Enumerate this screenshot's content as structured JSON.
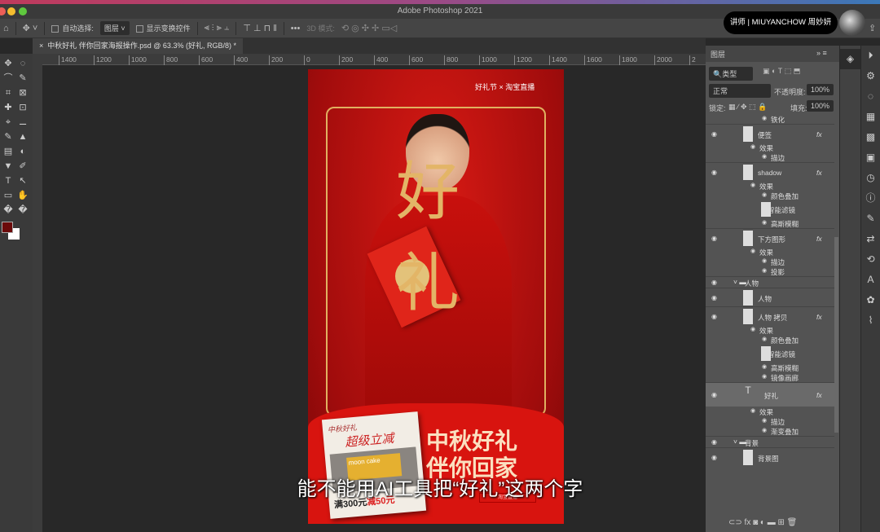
{
  "app": {
    "title": "Adobe Photoshop 2021"
  },
  "options": {
    "auto_select_label": "自动选择:",
    "auto_select_value": "图层",
    "show_transform_label": "显示变换控件",
    "mode_3d": "3D 模式:"
  },
  "badge": {
    "text": "讲师 | MIUYANCHOW 周妙妍"
  },
  "document": {
    "tab": "中秋好礼 伴你回家海报操作.psd @ 63.3% (好礼, RGB/8) *"
  },
  "ruler": [
    "1400",
    "1200",
    "1000",
    "800",
    "600",
    "400",
    "200",
    "0",
    "200",
    "400",
    "600",
    "800",
    "1000",
    "1200",
    "1400",
    "1600",
    "1800",
    "2000",
    "2"
  ],
  "colors": {
    "foreground": "#6b0a0a",
    "background": "#ffffff",
    "poster_red": "#d8140f",
    "gold": "#e3b567"
  },
  "poster": {
    "brand": "好礼节 × 淘宝直播",
    "big_text": "好礼",
    "headline1": "中秋好礼",
    "headline2": "伴你回家",
    "card_line1": "中秋好礼",
    "card_line2": "超级立减",
    "card_product": "moon cake",
    "card_price_a": "满300元",
    "card_price_b": "减50元",
    "live_label": "淘宝直播"
  },
  "caption": "能不能用AI工具把“好礼”这两个字",
  "layers_panel": {
    "title": "图层",
    "filter": "类型",
    "blend": "正常",
    "opacity_label": "不透明度:",
    "opacity": "100%",
    "lock_label": "锁定:",
    "fill_label": "填充:",
    "fill": "100%",
    "rows": [
      {
        "name": "铁化",
        "kind": "sub2"
      },
      {
        "name": "便签",
        "kind": "layer",
        "fx": "fx"
      },
      {
        "name": "效果",
        "kind": "sub1"
      },
      {
        "name": "描边",
        "kind": "sub2"
      },
      {
        "name": "shadow",
        "kind": "layer",
        "fx": "fx"
      },
      {
        "name": "效果",
        "kind": "sub1"
      },
      {
        "name": "颜色叠加",
        "kind": "sub2"
      },
      {
        "name": "智能滤镜",
        "kind": "filter"
      },
      {
        "name": "高斯模糊",
        "kind": "sub2"
      },
      {
        "name": "下方图形",
        "kind": "layer",
        "fx": "fx"
      },
      {
        "name": "效果",
        "kind": "sub1"
      },
      {
        "name": "描边",
        "kind": "sub2"
      },
      {
        "name": "投影",
        "kind": "sub2"
      },
      {
        "name": "人物",
        "kind": "group"
      },
      {
        "name": "人物",
        "kind": "layer",
        "fx": ""
      },
      {
        "name": "人物 拷贝",
        "kind": "layer",
        "fx": "fx"
      },
      {
        "name": "效果",
        "kind": "sub1"
      },
      {
        "name": "颜色叠加",
        "kind": "sub2"
      },
      {
        "name": "智能滤镜",
        "kind": "filter"
      },
      {
        "name": "高斯模糊",
        "kind": "sub2"
      },
      {
        "name": "镜像画廊",
        "kind": "sub2"
      },
      {
        "name": "好礼",
        "kind": "text",
        "fx": "fx"
      },
      {
        "name": "效果",
        "kind": "sub1"
      },
      {
        "name": "描边",
        "kind": "sub2"
      },
      {
        "name": "渐变叠加",
        "kind": "sub2"
      },
      {
        "name": "背景",
        "kind": "group"
      },
      {
        "name": "背景图",
        "kind": "layer",
        "fx": ""
      }
    ]
  }
}
